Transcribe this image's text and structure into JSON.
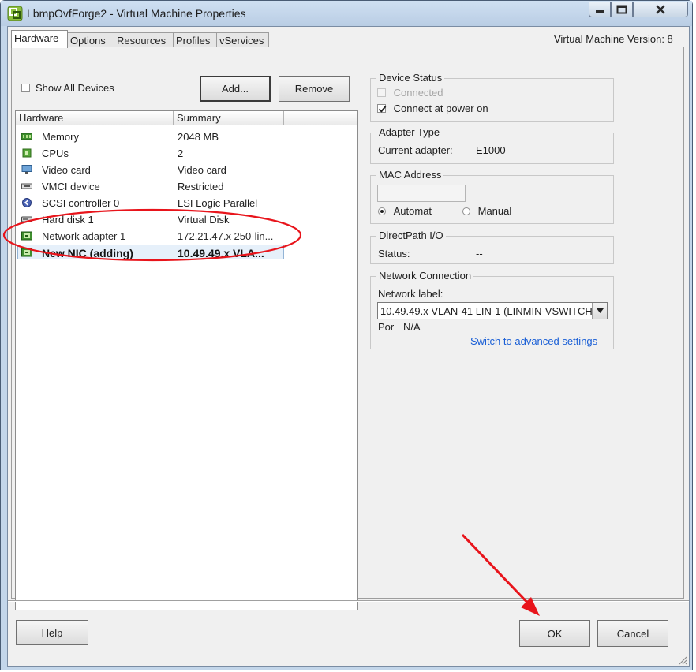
{
  "window": {
    "title": "LbmpOvfForge2 - Virtual Machine Properties",
    "icon": "vsphere-app-icon"
  },
  "tabs": [
    {
      "label": "Hardware",
      "active": true
    },
    {
      "label": "Options",
      "active": false
    },
    {
      "label": "Resources",
      "active": false
    },
    {
      "label": "Profiles",
      "active": false
    },
    {
      "label": "vServices",
      "active": false
    }
  ],
  "vm_version": "Virtual Machine Version: 8",
  "hardware_panel": {
    "show_all_devices_label": "Show All Devices",
    "show_all_devices_checked": false,
    "add_label": "Add...",
    "remove_label": "Remove",
    "columns": [
      "Hardware",
      "Summary"
    ],
    "rows": [
      {
        "icon": "memory-icon",
        "name": "Memory",
        "summary": "2048 MB"
      },
      {
        "icon": "cpu-icon",
        "name": "CPUs",
        "summary": "2"
      },
      {
        "icon": "monitor-icon",
        "name": "Video card",
        "summary": "Video card"
      },
      {
        "icon": "vmci-icon",
        "name": "VMCI device",
        "summary": "Restricted"
      },
      {
        "icon": "scsi-controller-icon",
        "name": "SCSI controller 0",
        "summary": "LSI Logic Parallel"
      },
      {
        "icon": "hard-disk-icon",
        "name": "Hard disk 1",
        "summary": "Virtual Disk"
      },
      {
        "icon": "network-adapter-icon",
        "name": "Network adapter 1",
        "summary": "172.21.47.x 250-lin..."
      },
      {
        "icon": "network-adapter-icon",
        "name": "New NIC (adding)",
        "summary": "10.49.49.x VLA...",
        "selected": true
      }
    ]
  },
  "device_status": {
    "legend": "Device Status",
    "connected_label": "Connected",
    "connected_checked": false,
    "connect_power_label": "Connect at power on",
    "connect_power_checked": true
  },
  "adapter_type": {
    "legend": "Adapter Type",
    "current_label": "Current adapter:",
    "current_value": "E1000"
  },
  "mac_address": {
    "legend": "MAC Address",
    "value": "",
    "automatic_label": "Automat",
    "manual_label": "Manual",
    "selected": "automatic"
  },
  "directpath": {
    "legend": "DirectPath I/O",
    "status_label": "Status:",
    "status_value": "--"
  },
  "network_connection": {
    "legend": "Network Connection",
    "label_caption": "Network label:",
    "selected_value": "10.49.49.x VLAN-41 LIN-1 (LINMIN-VSWITCH",
    "port_label": "Por",
    "port_value": "N/A",
    "advanced_link": "Switch to advanced settings"
  },
  "footer": {
    "help_label": "Help",
    "ok_label": "OK",
    "cancel_label": "Cancel"
  },
  "annotation_color": "#e8141b"
}
